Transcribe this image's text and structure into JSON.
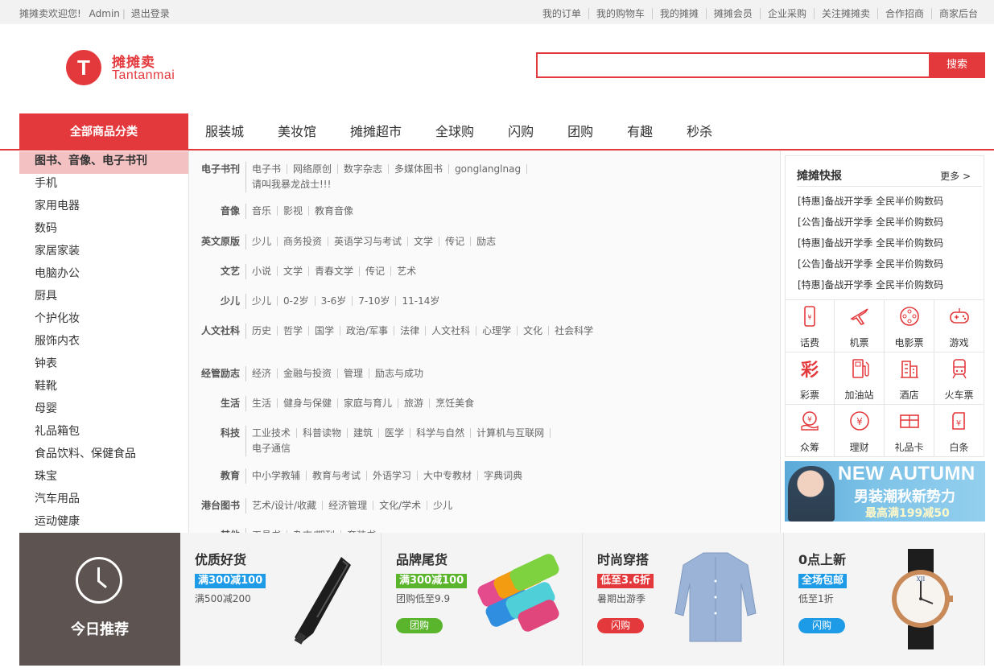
{
  "topbar": {
    "welcome": "摊摊卖欢迎您!",
    "user": "Admin",
    "logout": "退出登录",
    "links": [
      "我的订单",
      "我的购物车",
      "我的摊摊",
      "摊摊会员",
      "企业采购",
      "关注摊摊卖",
      "合作招商",
      "商家后台"
    ]
  },
  "logo": {
    "letter": "T",
    "cn": "摊摊卖",
    "en": "Tantanmai"
  },
  "search": {
    "value": "",
    "placeholder": "",
    "button": "搜索"
  },
  "nav": {
    "all": "全部商品分类",
    "items": [
      "服装城",
      "美妆馆",
      "摊摊超市",
      "全球购",
      "闪购",
      "团购",
      "有趣",
      "秒杀"
    ]
  },
  "categories": [
    "图书、音像、电子书刊",
    "手机",
    "家用电器",
    "数码",
    "家居家装",
    "电脑办公",
    "厨具",
    "个护化妆",
    "服饰内衣",
    "钟表",
    "鞋靴",
    "母婴",
    "礼品箱包",
    "食品饮料、保健食品",
    "珠宝",
    "汽车用品",
    "运动健康"
  ],
  "submenu": [
    {
      "title": "电子书刊",
      "items": [
        "电子书",
        "网络原创",
        "数字杂志",
        "多媒体图书",
        "gonglanglnag",
        "请叫我暴龙战士!!!"
      ]
    },
    {
      "title": "音像",
      "items": [
        "音乐",
        "影视",
        "教育音像"
      ]
    },
    {
      "title": "英文原版",
      "items": [
        "少儿",
        "商务投资",
        "英语学习与考试",
        "文学",
        "传记",
        "励志"
      ]
    },
    {
      "title": "文艺",
      "items": [
        "小说",
        "文学",
        "青春文学",
        "传记",
        "艺术"
      ]
    },
    {
      "title": "少儿",
      "items": [
        "少儿",
        "0-2岁",
        "3-6岁",
        "7-10岁",
        "11-14岁"
      ]
    },
    {
      "title": "人文社科",
      "items": [
        "历史",
        "哲学",
        "国学",
        "政治/军事",
        "法律",
        "人文社科",
        "心理学",
        "文化",
        "社会科学"
      ]
    },
    {
      "title": "经管励志",
      "items": [
        "经济",
        "金融与投资",
        "管理",
        "励志与成功"
      ]
    },
    {
      "title": "生活",
      "items": [
        "生活",
        "健身与保健",
        "家庭与育儿",
        "旅游",
        "烹饪美食"
      ]
    },
    {
      "title": "科技",
      "items": [
        "工业技术",
        "科普读物",
        "建筑",
        "医学",
        "科学与自然",
        "计算机与互联网",
        "电子通信"
      ]
    },
    {
      "title": "教育",
      "items": [
        "中小学教辅",
        "教育与考试",
        "外语学习",
        "大中专教材",
        "字典词典"
      ]
    },
    {
      "title": "港台图书",
      "items": [
        "艺术/设计/收藏",
        "经济管理",
        "文化/学术",
        "少儿"
      ]
    },
    {
      "title": "其他",
      "items": [
        "工具书",
        "杂志/期刊",
        "套装书"
      ]
    }
  ],
  "news": {
    "title": "摊摊快报",
    "more": "更多 >",
    "items": [
      "[特惠]备战开学季 全民半价购数码",
      "[公告]备战开学季 全民半价购数码",
      "[特惠]备战开学季 全民半价购数码",
      "[公告]备战开学季 全民半价购数码",
      "[特惠]备战开学季 全民半价购数码"
    ]
  },
  "services": [
    {
      "label": "话费",
      "icon": "phone-icon"
    },
    {
      "label": "机票",
      "icon": "plane-icon"
    },
    {
      "label": "电影票",
      "icon": "film-icon"
    },
    {
      "label": "游戏",
      "icon": "gamepad-icon"
    },
    {
      "label": "彩票",
      "icon": "lottery-icon"
    },
    {
      "label": "加油站",
      "icon": "gas-station-icon"
    },
    {
      "label": "酒店",
      "icon": "hotel-icon"
    },
    {
      "label": "火车票",
      "icon": "train-icon"
    },
    {
      "label": "众筹",
      "icon": "crowdfund-icon"
    },
    {
      "label": "理财",
      "icon": "finance-icon"
    },
    {
      "label": "礼品卡",
      "icon": "gift-card-icon"
    },
    {
      "label": "白条",
      "icon": "credit-icon"
    }
  ],
  "banner": {
    "line1": "NEW AUTUMN",
    "line2": "男装潮秋新势力",
    "line3": "最高满199减50"
  },
  "recommend": {
    "title": "今日推荐",
    "cards": [
      {
        "title": "优质好货",
        "badge": "满300减100",
        "badge_color": "#1e9be6",
        "sub": "满500减200",
        "pill": "",
        "pill_color": ""
      },
      {
        "title": "品牌尾货",
        "badge": "满300减100",
        "badge_color": "#5ab52c",
        "sub": "团购低至9.9",
        "pill": "团购",
        "pill_color": "#5ab52c"
      },
      {
        "title": "时尚穿搭",
        "badge": "低至3.6折",
        "badge_color": "#e4393c",
        "sub": "暑期出游季",
        "pill": "闪购",
        "pill_color": "#e4393c"
      },
      {
        "title": "0点上新",
        "badge": "全场包邮",
        "badge_color": "#1e9be6",
        "sub": "低至1折",
        "pill": "闪购",
        "pill_color": "#1e9be6"
      }
    ]
  },
  "colors": {
    "brand": "#e4393c",
    "highlight": "#f3c1c2"
  }
}
